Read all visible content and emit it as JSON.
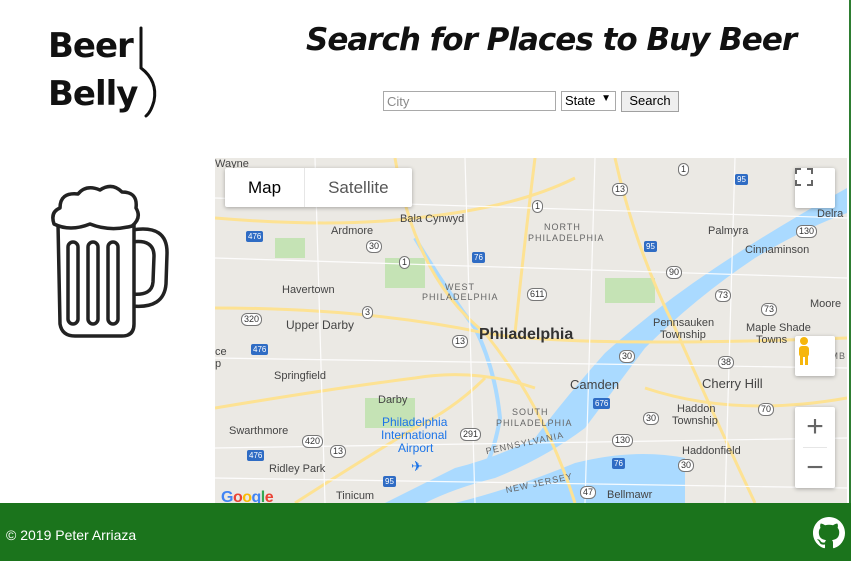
{
  "logo": {
    "line1": "Beer",
    "line2": "Belly"
  },
  "header": {
    "title": "Search for Places to Buy Beer"
  },
  "search": {
    "city_placeholder": "City",
    "state_value": "State",
    "search_label": "Search"
  },
  "map": {
    "type_map": "Map",
    "type_satellite": "Satellite",
    "zoom_in": "+",
    "zoom_out": "−",
    "google": "Google",
    "labels": {
      "philadelphia": "Philadelphia",
      "camden": "Camden",
      "ardmore": "Ardmore",
      "bala": "Bala Cynwyd",
      "havertown": "Havertown",
      "upper_darby": "Upper Darby",
      "springfield": "Springfield",
      "darby": "Darby",
      "swarthmore": "Swarthmore",
      "ridley": "Ridley Park",
      "tinicum": "Tinicum",
      "palmyra": "Palmyra",
      "cinnaminson": "Cinnaminson",
      "moore": "Moore",
      "delra": "Delra",
      "pennsauken": "Pennsauken",
      "township": "Township",
      "maple_shade": "Maple Shade",
      "towns": "Towns",
      "cherry_hill": "Cherry Hill",
      "haddon": "Haddon",
      "haddon_township": "Township",
      "haddonfield": "Haddonfield",
      "bellmawr": "Bellmawr",
      "north_phila_1": "NORTH",
      "north_phila_2": "PHILADELPHIA",
      "west_phila_1": "WEST",
      "west_phila_2": "PHILADELPHIA",
      "south_phila_1": "SOUTH",
      "south_phila_2": "PHILADELPHIA",
      "pennsylvania": "PENNSYLVANIA",
      "new_jersey": "NEW JERSEY",
      "airport_1": "Philadelphia",
      "airport_2": "International",
      "airport_3": "Airport",
      "wayne": "Wayne",
      "ramb": "RAMB",
      "ce": "ce",
      "ap": "p"
    }
  },
  "footer": {
    "copyright": "© 2019 Peter Arriaza"
  },
  "colors": {
    "footer": "#1b741c",
    "water": "#aadaff",
    "road": "#fde293"
  }
}
